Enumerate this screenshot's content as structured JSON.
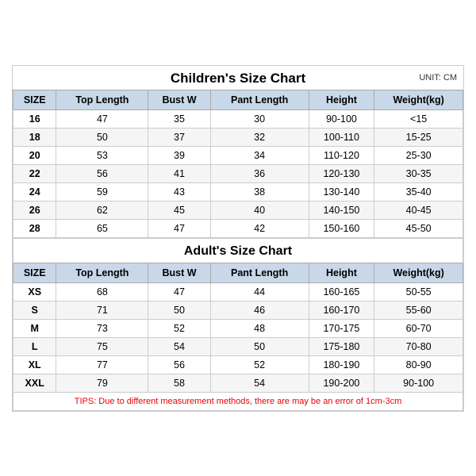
{
  "title": "Children's Size Chart",
  "unit": "UNIT: CM",
  "children": {
    "headers": [
      "SIZE",
      "Top Length",
      "Bust W",
      "Pant Length",
      "Height",
      "Weight(kg)"
    ],
    "rows": [
      [
        "16",
        "47",
        "35",
        "30",
        "90-100",
        "<15"
      ],
      [
        "18",
        "50",
        "37",
        "32",
        "100-110",
        "15-25"
      ],
      [
        "20",
        "53",
        "39",
        "34",
        "110-120",
        "25-30"
      ],
      [
        "22",
        "56",
        "41",
        "36",
        "120-130",
        "30-35"
      ],
      [
        "24",
        "59",
        "43",
        "38",
        "130-140",
        "35-40"
      ],
      [
        "26",
        "62",
        "45",
        "40",
        "140-150",
        "40-45"
      ],
      [
        "28",
        "65",
        "47",
        "42",
        "150-160",
        "45-50"
      ]
    ]
  },
  "adults": {
    "title": "Adult's Size Chart",
    "headers": [
      "SIZE",
      "Top Length",
      "Bust W",
      "Pant Length",
      "Height",
      "Weight(kg)"
    ],
    "rows": [
      [
        "XS",
        "68",
        "47",
        "44",
        "160-165",
        "50-55"
      ],
      [
        "S",
        "71",
        "50",
        "46",
        "160-170",
        "55-60"
      ],
      [
        "M",
        "73",
        "52",
        "48",
        "170-175",
        "60-70"
      ],
      [
        "L",
        "75",
        "54",
        "50",
        "175-180",
        "70-80"
      ],
      [
        "XL",
        "77",
        "56",
        "52",
        "180-190",
        "80-90"
      ],
      [
        "XXL",
        "79",
        "58",
        "54",
        "190-200",
        "90-100"
      ]
    ]
  },
  "tips": "TIPS: Due to different measurement methods, there are may be an error of 1cm-3cm"
}
